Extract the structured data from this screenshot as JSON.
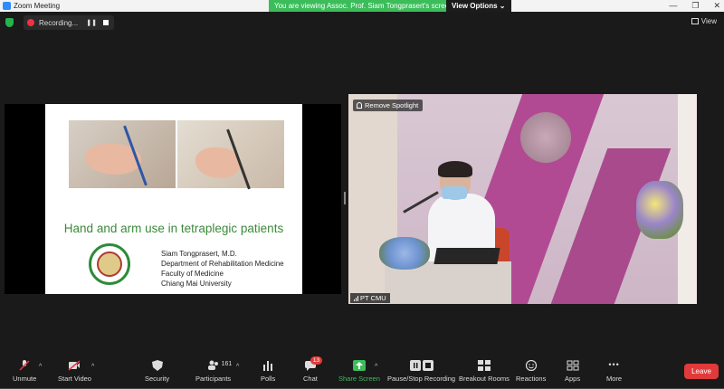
{
  "window": {
    "app_title": "Zoom Meeting",
    "minimize": "—",
    "restore": "❐",
    "close": "✕"
  },
  "banner": {
    "message": "You are viewing Assoc. Prof. Siam Tongprasert's screen",
    "view_options": "View Options ⌄"
  },
  "topbar": {
    "recording_label": "Recording...",
    "pause_glyph": "❚❚",
    "view_label": "View"
  },
  "slide": {
    "title": "Hand and arm use in tetraplegic patients",
    "lines": [
      "Siam Tongprasert, M.D.",
      "Department of Rehabilitation Medicine",
      "Faculty of Medicine",
      "Chiang Mai University"
    ]
  },
  "video": {
    "remove_spotlight": "Remove Spotlight",
    "participant_name": "PT CMU"
  },
  "toolbar": {
    "unmute": "Unmute",
    "start_video": "Start Video",
    "security": "Security",
    "participants": "Participants",
    "participants_count": "161",
    "polls": "Polls",
    "chat": "Chat",
    "chat_badge": "13",
    "share_screen": "Share Screen",
    "pause_stop_recording": "Pause/Stop Recording",
    "breakout_rooms": "Breakout Rooms",
    "reactions": "Reactions",
    "apps": "Apps",
    "more": "More",
    "leave": "Leave",
    "caret": "^",
    "more_glyph": "•••"
  },
  "colors": {
    "share_green": "#3bbd5a",
    "leave_red": "#e03a3a",
    "slide_title_green": "#3a8a3a"
  }
}
